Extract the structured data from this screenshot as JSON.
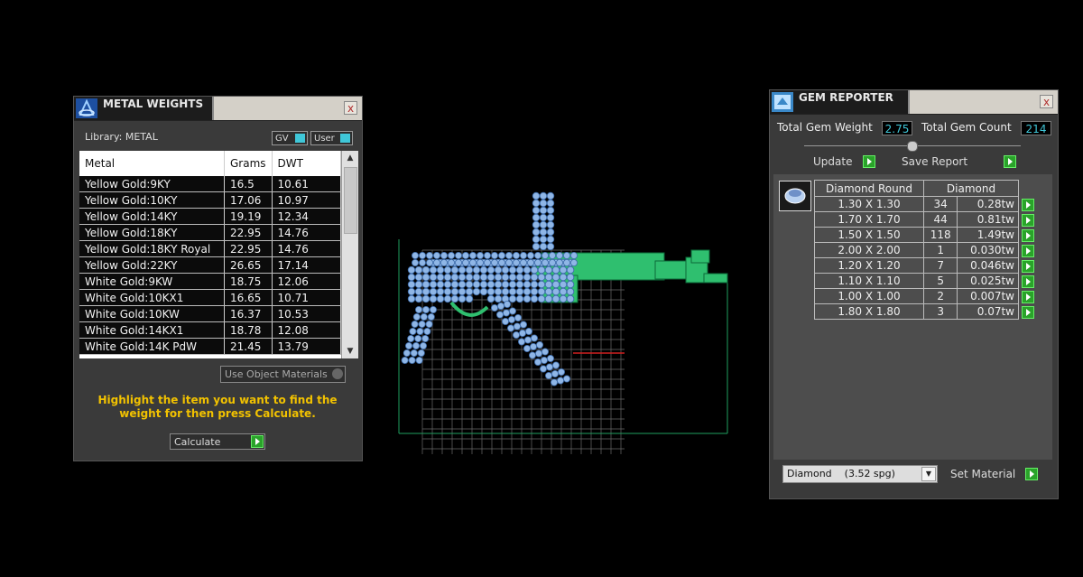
{
  "metal_weights": {
    "title": "METAL WEIGHTS",
    "close": "x",
    "library_label": "Library: METAL",
    "toggle_gv": "GV",
    "toggle_user": "User",
    "columns": [
      "Metal",
      "Grams",
      "DWT"
    ],
    "rows": [
      [
        "Yellow Gold:9KY",
        "16.5",
        "10.61"
      ],
      [
        "Yellow Gold:10KY",
        "17.06",
        "10.97"
      ],
      [
        "Yellow Gold:14KY",
        "19.19",
        "12.34"
      ],
      [
        "Yellow Gold:18KY",
        "22.95",
        "14.76"
      ],
      [
        "Yellow Gold:18KY Royal",
        "22.95",
        "14.76"
      ],
      [
        "Yellow Gold:22KY",
        "26.65",
        "17.14"
      ],
      [
        "White Gold:9KW",
        "18.75",
        "12.06"
      ],
      [
        "White Gold:10KX1",
        "16.65",
        "10.71"
      ],
      [
        "White Gold:10KW",
        "16.37",
        "10.53"
      ],
      [
        "White Gold:14KX1",
        "18.78",
        "12.08"
      ],
      [
        "White Gold:14K PdW",
        "21.45",
        "13.79"
      ]
    ],
    "use_object_materials": "Use Object Materials",
    "hint": "Highlight the item you want to find the weight for then press Calculate.",
    "calculate": "Calculate"
  },
  "gem_reporter": {
    "title": "GEM REPORTER",
    "close": "x",
    "total_gem_weight_label": "Total Gem Weight",
    "total_gem_weight": "2.75",
    "total_gem_count_label": "Total Gem Count",
    "total_gem_count": "214",
    "update": "Update",
    "save_report": "Save Report",
    "col_size": "Diamond Round",
    "col_type": "Diamond",
    "rows": [
      [
        "1.30 X 1.30",
        "34",
        "0.28tw"
      ],
      [
        "1.70 X 1.70",
        "44",
        "0.81tw"
      ],
      [
        "1.50 X 1.50",
        "118",
        "1.49tw"
      ],
      [
        "2.00 X 2.00",
        "1",
        "0.030tw"
      ],
      [
        "1.20 X 1.20",
        "7",
        "0.046tw"
      ],
      [
        "1.10 X 1.10",
        "5",
        "0.025tw"
      ],
      [
        "1.00 X 1.00",
        "2",
        "0.007tw"
      ],
      [
        "1.80 X 1.80",
        "3",
        "0.07tw"
      ]
    ],
    "material_select": "Diamond    (3.52 spg)",
    "set_material": "Set Material"
  },
  "colors": {
    "accent_green": "#2aa32a",
    "gem_blue": "#8fb6e6",
    "model_green": "#2fbf6f",
    "field_cyan": "#3fc7d8",
    "hint_yellow": "#f2c200"
  }
}
